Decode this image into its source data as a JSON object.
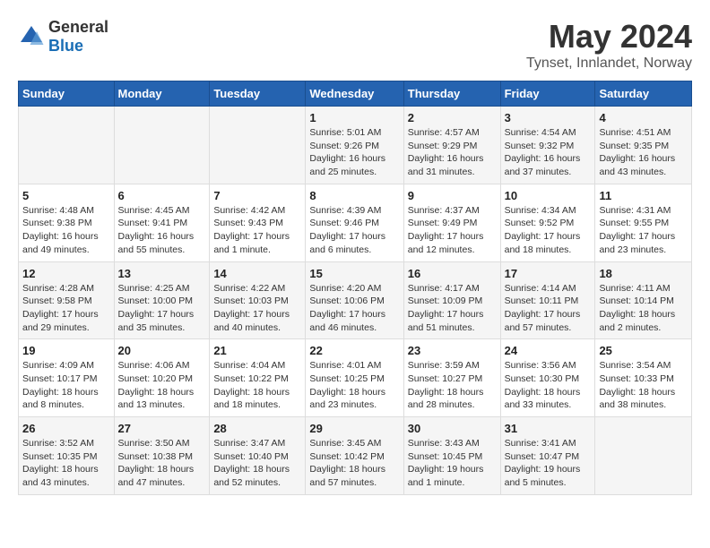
{
  "logo": {
    "general": "General",
    "blue": "Blue"
  },
  "title": "May 2024",
  "subtitle": "Tynset, Innlandet, Norway",
  "days_of_week": [
    "Sunday",
    "Monday",
    "Tuesday",
    "Wednesday",
    "Thursday",
    "Friday",
    "Saturday"
  ],
  "weeks": [
    [
      {
        "day": "",
        "info": ""
      },
      {
        "day": "",
        "info": ""
      },
      {
        "day": "",
        "info": ""
      },
      {
        "day": "1",
        "info": "Sunrise: 5:01 AM\nSunset: 9:26 PM\nDaylight: 16 hours\nand 25 minutes."
      },
      {
        "day": "2",
        "info": "Sunrise: 4:57 AM\nSunset: 9:29 PM\nDaylight: 16 hours\nand 31 minutes."
      },
      {
        "day": "3",
        "info": "Sunrise: 4:54 AM\nSunset: 9:32 PM\nDaylight: 16 hours\nand 37 minutes."
      },
      {
        "day": "4",
        "info": "Sunrise: 4:51 AM\nSunset: 9:35 PM\nDaylight: 16 hours\nand 43 minutes."
      }
    ],
    [
      {
        "day": "5",
        "info": "Sunrise: 4:48 AM\nSunset: 9:38 PM\nDaylight: 16 hours\nand 49 minutes."
      },
      {
        "day": "6",
        "info": "Sunrise: 4:45 AM\nSunset: 9:41 PM\nDaylight: 16 hours\nand 55 minutes."
      },
      {
        "day": "7",
        "info": "Sunrise: 4:42 AM\nSunset: 9:43 PM\nDaylight: 17 hours\nand 1 minute."
      },
      {
        "day": "8",
        "info": "Sunrise: 4:39 AM\nSunset: 9:46 PM\nDaylight: 17 hours\nand 6 minutes."
      },
      {
        "day": "9",
        "info": "Sunrise: 4:37 AM\nSunset: 9:49 PM\nDaylight: 17 hours\nand 12 minutes."
      },
      {
        "day": "10",
        "info": "Sunrise: 4:34 AM\nSunset: 9:52 PM\nDaylight: 17 hours\nand 18 minutes."
      },
      {
        "day": "11",
        "info": "Sunrise: 4:31 AM\nSunset: 9:55 PM\nDaylight: 17 hours\nand 23 minutes."
      }
    ],
    [
      {
        "day": "12",
        "info": "Sunrise: 4:28 AM\nSunset: 9:58 PM\nDaylight: 17 hours\nand 29 minutes."
      },
      {
        "day": "13",
        "info": "Sunrise: 4:25 AM\nSunset: 10:00 PM\nDaylight: 17 hours\nand 35 minutes."
      },
      {
        "day": "14",
        "info": "Sunrise: 4:22 AM\nSunset: 10:03 PM\nDaylight: 17 hours\nand 40 minutes."
      },
      {
        "day": "15",
        "info": "Sunrise: 4:20 AM\nSunset: 10:06 PM\nDaylight: 17 hours\nand 46 minutes."
      },
      {
        "day": "16",
        "info": "Sunrise: 4:17 AM\nSunset: 10:09 PM\nDaylight: 17 hours\nand 51 minutes."
      },
      {
        "day": "17",
        "info": "Sunrise: 4:14 AM\nSunset: 10:11 PM\nDaylight: 17 hours\nand 57 minutes."
      },
      {
        "day": "18",
        "info": "Sunrise: 4:11 AM\nSunset: 10:14 PM\nDaylight: 18 hours\nand 2 minutes."
      }
    ],
    [
      {
        "day": "19",
        "info": "Sunrise: 4:09 AM\nSunset: 10:17 PM\nDaylight: 18 hours\nand 8 minutes."
      },
      {
        "day": "20",
        "info": "Sunrise: 4:06 AM\nSunset: 10:20 PM\nDaylight: 18 hours\nand 13 minutes."
      },
      {
        "day": "21",
        "info": "Sunrise: 4:04 AM\nSunset: 10:22 PM\nDaylight: 18 hours\nand 18 minutes."
      },
      {
        "day": "22",
        "info": "Sunrise: 4:01 AM\nSunset: 10:25 PM\nDaylight: 18 hours\nand 23 minutes."
      },
      {
        "day": "23",
        "info": "Sunrise: 3:59 AM\nSunset: 10:27 PM\nDaylight: 18 hours\nand 28 minutes."
      },
      {
        "day": "24",
        "info": "Sunrise: 3:56 AM\nSunset: 10:30 PM\nDaylight: 18 hours\nand 33 minutes."
      },
      {
        "day": "25",
        "info": "Sunrise: 3:54 AM\nSunset: 10:33 PM\nDaylight: 18 hours\nand 38 minutes."
      }
    ],
    [
      {
        "day": "26",
        "info": "Sunrise: 3:52 AM\nSunset: 10:35 PM\nDaylight: 18 hours\nand 43 minutes."
      },
      {
        "day": "27",
        "info": "Sunrise: 3:50 AM\nSunset: 10:38 PM\nDaylight: 18 hours\nand 47 minutes."
      },
      {
        "day": "28",
        "info": "Sunrise: 3:47 AM\nSunset: 10:40 PM\nDaylight: 18 hours\nand 52 minutes."
      },
      {
        "day": "29",
        "info": "Sunrise: 3:45 AM\nSunset: 10:42 PM\nDaylight: 18 hours\nand 57 minutes."
      },
      {
        "day": "30",
        "info": "Sunrise: 3:43 AM\nSunset: 10:45 PM\nDaylight: 19 hours\nand 1 minute."
      },
      {
        "day": "31",
        "info": "Sunrise: 3:41 AM\nSunset: 10:47 PM\nDaylight: 19 hours\nand 5 minutes."
      },
      {
        "day": "",
        "info": ""
      }
    ]
  ]
}
